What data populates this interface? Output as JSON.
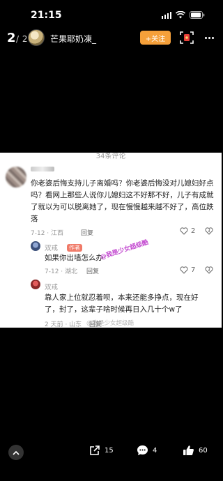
{
  "status": {
    "time": "21:15"
  },
  "header": {
    "page_current": "2",
    "page_total": "/ 2",
    "username": "芒果耶奶凍_",
    "follow_label": "+关注"
  },
  "post": {
    "cut_title": "34条评论",
    "comment1": {
      "text": "你老婆后悔支持儿子离婚吗？你老婆后悔没对儿媳妇好点吗？看网上那些人说你儿媳妇这不好那不好，儿子有成就了就以为可以脱离她了，现在慢慢越来越不好了，高位跌落",
      "meta": "7-12 · 江西",
      "reply_label": "回复",
      "likes": "2"
    },
    "reply1": {
      "name": "双戒",
      "badge": "作者",
      "text": "如果你出墙怎么办",
      "meta": "7-12 · 湖北",
      "reply_label": "回复",
      "likes": "7"
    },
    "reply2": {
      "name": "双戒",
      "text": "靠人家上位就忍着呗，本来还能多挣点，现在好了，封了，这辈子啥时候再日入几十个w了",
      "meta": "2 天前 · 山东",
      "reply_label": "回复"
    },
    "watermark": "@我是少女超级酷",
    "watermark2": "@我是少女超级酷"
  },
  "bottom": {
    "share_count": "15",
    "comment_count": "4",
    "like_count": "60"
  },
  "colors": {
    "accent": "#f5a03a",
    "watermark": "#c34bd0"
  }
}
